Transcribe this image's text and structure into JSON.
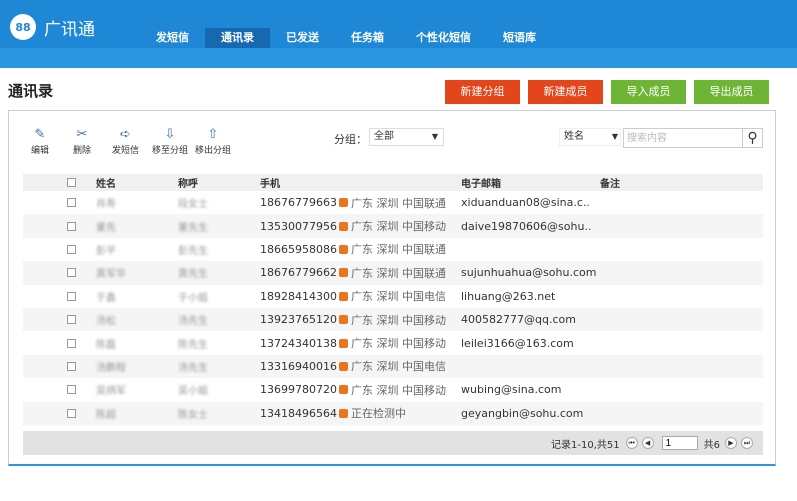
{
  "app": {
    "logo_mark": "88",
    "logo_text": "广讯通"
  },
  "nav": [
    "发短信",
    "通讯录",
    "已发送",
    "任务箱",
    "个性化短信",
    "短语库"
  ],
  "page_title": "通讯录",
  "actions": [
    {
      "label": "新建分组",
      "color": "#e3461a"
    },
    {
      "label": "新建成员",
      "color": "#e3461a"
    },
    {
      "label": "导入成员",
      "color": "#6eb536"
    },
    {
      "label": "导出成员",
      "color": "#6eb536"
    }
  ],
  "toolbar": [
    {
      "label": "编辑",
      "icon": "edit-icon",
      "glyph": "✎"
    },
    {
      "label": "删除",
      "icon": "delete-icon",
      "glyph": "✂"
    },
    {
      "label": "发短信",
      "icon": "send-sms-icon",
      "glyph": "➪"
    },
    {
      "label": "移至分组",
      "icon": "move-group-icon",
      "glyph": "⇩"
    },
    {
      "label": "移出分组",
      "icon": "remove-group-icon",
      "glyph": "⇧"
    }
  ],
  "group_filter": {
    "label": "分组：",
    "value": "全部"
  },
  "search": {
    "field": "姓名",
    "placeholder": "搜索内容"
  },
  "columns": {
    "name": "姓名",
    "title": "称呼",
    "phone": "手机",
    "email": "电子邮箱",
    "note": "备注"
  },
  "rows": [
    {
      "name": "肖寿",
      "title": "段女士",
      "phone": "18676779663",
      "location": "广东 深圳 中国联通",
      "email": "xiduanduan08@sina.c..",
      "note": ""
    },
    {
      "name": "董先",
      "title": "董先生",
      "phone": "13530077956",
      "location": "广东 深圳 中国移动",
      "email": "daive19870606@sohu..",
      "note": ""
    },
    {
      "name": "彭平",
      "title": "彭先生",
      "phone": "18665958086",
      "location": "广东 深圳 中国联通",
      "email": "",
      "note": ""
    },
    {
      "name": "黄军华",
      "title": "黄先生",
      "phone": "18676779662",
      "location": "广东 深圳 中国联通",
      "email": "sujunhuahua@sohu.com",
      "note": ""
    },
    {
      "name": "于鑫",
      "title": "于小姐",
      "phone": "18928414300",
      "location": "广东 深圳 中国电信",
      "email": "lihuang@263.net",
      "note": ""
    },
    {
      "name": "汤松",
      "title": "汤先生",
      "phone": "13923765120",
      "location": "广东 深圳 中国移动",
      "email": "400582777@qq.com",
      "note": ""
    },
    {
      "name": "陈磊",
      "title": "陈先生",
      "phone": "13724340138",
      "location": "广东 深圳 中国移动",
      "email": "leilei3166@163.com",
      "note": ""
    },
    {
      "name": "汤鹏程",
      "title": "汤先生",
      "phone": "13316940016",
      "location": "广东 深圳 中国电信",
      "email": "",
      "note": ""
    },
    {
      "name": "吴炳军",
      "title": "吴小姐",
      "phone": "13699780720",
      "location": "广东 深圳 中国移动",
      "email": "wubing@sina.com",
      "note": ""
    },
    {
      "name": "陈超",
      "title": "陈女士",
      "phone": "13418496564",
      "location": "正在检测中",
      "email": "geyangbin@sohu.com",
      "note": ""
    }
  ],
  "pagination": {
    "summary": "记录1-10,共51",
    "page": "1",
    "total": "共6"
  }
}
